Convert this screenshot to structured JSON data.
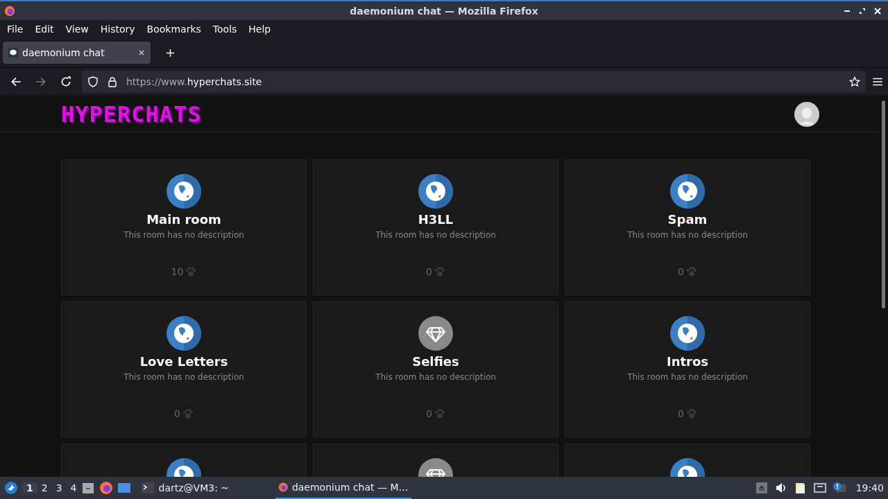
{
  "window": {
    "title": "daemonium chat — Mozilla Firefox"
  },
  "menu": [
    "File",
    "Edit",
    "View",
    "History",
    "Bookmarks",
    "Tools",
    "Help"
  ],
  "tabs": [
    {
      "label": "daemonium chat",
      "selected": true
    }
  ],
  "address": {
    "prefix": "https://www.",
    "host": "hyperchats.site"
  },
  "site": {
    "logo": "HYPERCHATS"
  },
  "rooms": [
    {
      "kind": "globe",
      "name": "Main room",
      "description": "This room has no description",
      "count": "10"
    },
    {
      "kind": "globe",
      "name": "H3LL",
      "description": "This room has no description",
      "count": "0"
    },
    {
      "kind": "globe",
      "name": "Spam",
      "description": "This room has no description",
      "count": "0"
    },
    {
      "kind": "globe",
      "name": "Love Letters",
      "description": "This room has no description",
      "count": "0"
    },
    {
      "kind": "diamond",
      "name": "Selfies",
      "description": "This room has no description",
      "count": "0"
    },
    {
      "kind": "globe",
      "name": "Intros",
      "description": "This room has no description",
      "count": "0"
    },
    {
      "kind": "globe"
    },
    {
      "kind": "diamond"
    },
    {
      "kind": "globe"
    }
  ],
  "taskbar": {
    "workspaces": [
      {
        "label": "1",
        "selected": true
      },
      {
        "label": "2",
        "selected": false
      },
      {
        "label": "3",
        "selected": false
      },
      {
        "label": "4",
        "selected": false
      }
    ],
    "tasks": [
      {
        "label": "dartz@VM3: ~",
        "kind": "terminal",
        "selected": false
      },
      {
        "label": "daemonium chat — M…",
        "kind": "firefox",
        "selected": true
      }
    ],
    "clock": "19:40"
  }
}
